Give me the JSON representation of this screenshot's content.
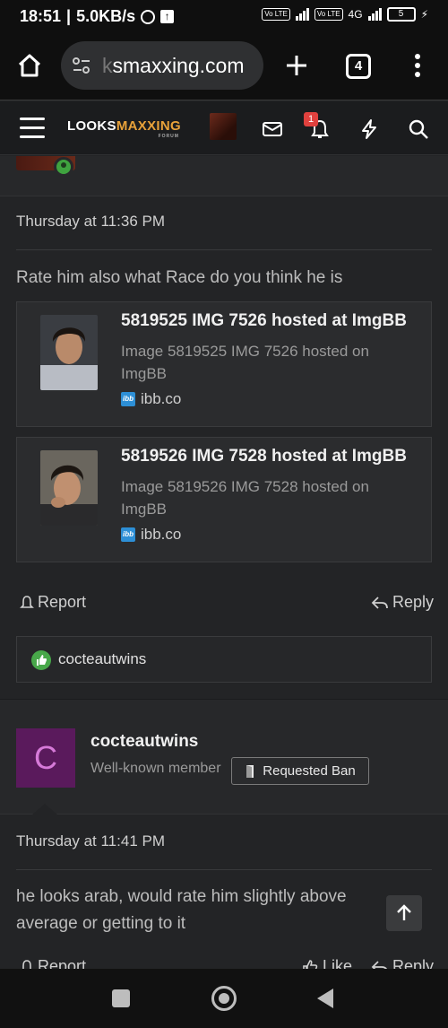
{
  "status_bar": {
    "time": "18:51",
    "speed": "5.0KB/s",
    "volte1": "Vo LTE",
    "volte2": "Vo LTE",
    "net": "4G",
    "battery": "5"
  },
  "browser": {
    "url_faded": "k",
    "url": "smaxxing.com",
    "tab_count": "4"
  },
  "site": {
    "logo_main": "LOOKS",
    "logo_accent": "MAXXING",
    "logo_sub": "FORUM",
    "notification_count": "1"
  },
  "post1": {
    "date": "Thursday at 11:36 PM",
    "body": "Rate him also what Race do you think he is",
    "embeds": [
      {
        "title": "5819525 IMG 7526 hosted at ImgBB",
        "description": "Image 5819525 IMG 7526 hosted on ImgBB",
        "source": "ibb.co",
        "source_icon_label": "ibb"
      },
      {
        "title": "5819526 IMG 7528 hosted at ImgBB",
        "description": "Image 5819526 IMG 7528 hosted on ImgBB",
        "source": "ibb.co",
        "source_icon_label": "ibb"
      }
    ],
    "report_label": "Report",
    "reply_label": "Reply",
    "reaction_user": "cocteautwins"
  },
  "post2": {
    "avatar_letter": "C",
    "username": "cocteautwins",
    "user_title": "Well-known member",
    "badge": "Requested Ban",
    "date": "Thursday at 11:41 PM",
    "body": "he looks arab, would rate him slightly above average or getting to it",
    "report_label": "Report",
    "like_label": "Like",
    "reply_label": "Reply"
  },
  "colors": {
    "accent": "#e8a23a",
    "avatar_bg": "#5a1a5c",
    "online": "#3fa33f",
    "notification": "#e0413e"
  }
}
